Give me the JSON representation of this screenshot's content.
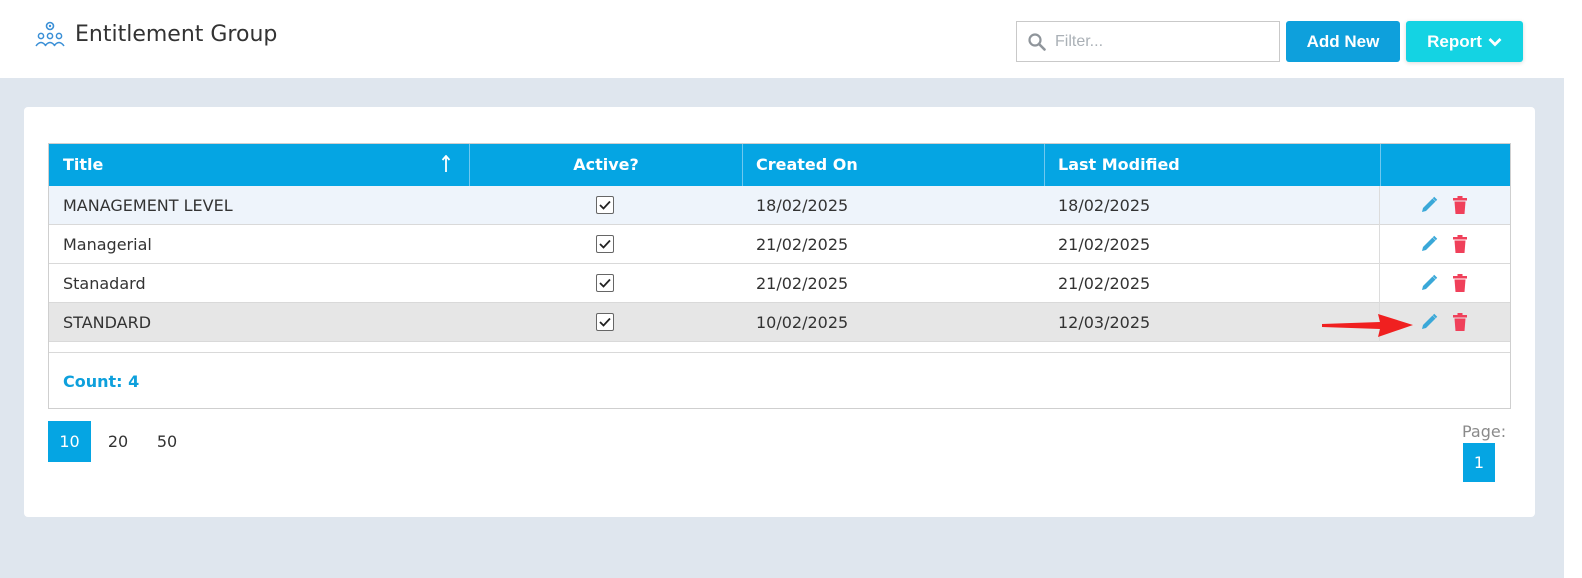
{
  "header": {
    "title": "Entitlement Group",
    "app_icon": "people-group-gear-icon",
    "filter_placeholder": "Filter...",
    "add_new_label": "Add New",
    "report_label": "Report"
  },
  "grid": {
    "columns": [
      "Title",
      "Active?",
      "Created On",
      "Last Modified",
      ""
    ],
    "sort": {
      "column": "Title",
      "direction": "ascending"
    },
    "rows": [
      {
        "title": "MANAGEMENT LEVEL",
        "active": true,
        "created_on": "18/02/2025",
        "last_modified": "18/02/2025"
      },
      {
        "title": "Managerial",
        "active": true,
        "created_on": "21/02/2025",
        "last_modified": "21/02/2025"
      },
      {
        "title": "Stanadard",
        "active": true,
        "created_on": "21/02/2025",
        "last_modified": "21/02/2025"
      },
      {
        "title": "STANDARD",
        "active": true,
        "created_on": "10/02/2025",
        "last_modified": "12/03/2025"
      }
    ],
    "count_label": "Count: 4"
  },
  "pager": {
    "page_sizes": [
      "10",
      "20",
      "50"
    ],
    "selected_page_size": "10",
    "page_label": "Page:",
    "current_page": "1"
  },
  "colors": {
    "accent": "#05a5e3",
    "report": "#14d3e3",
    "delete": "#f0405a",
    "edit": "#3aa8d8",
    "annotation_arrow": "#f02020"
  }
}
